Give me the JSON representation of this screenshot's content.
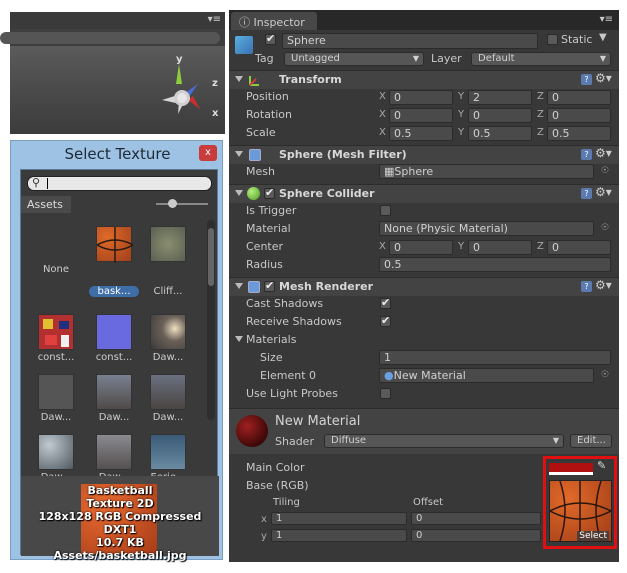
{
  "inspector": {
    "tab": "Inspector",
    "object_name": "Sphere",
    "static_label": "Static",
    "tag_label": "Tag",
    "tag_value": "Untagged",
    "layer_label": "Layer",
    "layer_value": "Default"
  },
  "transform": {
    "title": "Transform",
    "rows": [
      {
        "label": "Position",
        "x": "0",
        "y": "2",
        "z": "0"
      },
      {
        "label": "Rotation",
        "x": "0",
        "y": "0",
        "z": "0"
      },
      {
        "label": "Scale",
        "x": "0.5",
        "y": "0.5",
        "z": "0.5"
      }
    ]
  },
  "mesh_filter": {
    "title": "Sphere (Mesh Filter)",
    "mesh_label": "Mesh",
    "mesh_value": "Sphere"
  },
  "collider": {
    "title": "Sphere Collider",
    "is_trigger": "Is Trigger",
    "material_label": "Material",
    "material_value": "None (Physic Material)",
    "center_label": "Center",
    "center": {
      "x": "0",
      "y": "0",
      "z": "0"
    },
    "radius_label": "Radius",
    "radius_value": "0.5"
  },
  "renderer": {
    "title": "Mesh Renderer",
    "cast_shadows": "Cast Shadows",
    "receive_shadows": "Receive Shadows",
    "materials": "Materials",
    "size_label": "Size",
    "size_value": "1",
    "element_label": "Element 0",
    "element_value": "New Material",
    "light_probes": "Use Light Probes"
  },
  "material": {
    "name": "New Material",
    "shader_label": "Shader",
    "shader_value": "Diffuse",
    "edit_label": "Edit...",
    "main_color": "Main Color",
    "base_rgb": "Base (RGB)",
    "tiling": "Tiling",
    "offset": "Offset",
    "tx": "1",
    "ty": "1",
    "ox": "0",
    "oy": "0",
    "select_label": "Select"
  },
  "xyz": {
    "x": "X",
    "y": "Y",
    "z": "Z"
  },
  "select_texture": {
    "title": "Select Texture",
    "close": "x",
    "assets_tab": "Assets",
    "items": [
      {
        "label": "None"
      },
      {
        "label": "bask..."
      },
      {
        "label": "Cliff..."
      },
      {
        "label": "const..."
      },
      {
        "label": "const..."
      },
      {
        "label": "Daw..."
      },
      {
        "label": "Daw..."
      },
      {
        "label": "Daw..."
      },
      {
        "label": "Daw..."
      },
      {
        "label": "Daw..."
      },
      {
        "label": "Daw..."
      },
      {
        "label": "Eerie..."
      }
    ],
    "preview_lines": [
      "Basketball",
      "Texture 2D",
      "128x128  RGB Compressed DXT1",
      "10.7 KB",
      "Assets/basketball.jpg"
    ]
  },
  "gizmo": {
    "y": "y",
    "z": "z",
    "x": "x"
  }
}
